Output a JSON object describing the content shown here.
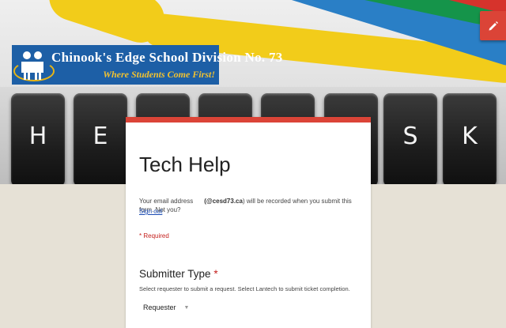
{
  "banner": {
    "keys": [
      "H",
      "E",
      "",
      "",
      "",
      "",
      "S",
      "K"
    ],
    "logo": {
      "name": "Chinook's Edge School Division No. 73",
      "tagline": "Where Students Come First!"
    }
  },
  "edit_button": {
    "icon": "pencil-icon"
  },
  "form": {
    "accent_color": "#db4437",
    "title": "Tech Help",
    "email_label": "Your email address",
    "email_domain": "(@cesd73.ca",
    "email_notice": ") will be recorded when you submit this form. Not you?",
    "sign_out": "Sign out",
    "required_note": "* Required",
    "question": {
      "title": "Submitter Type",
      "required_mark": "*",
      "description": "Select requester to submit a request. Select Lantech to submit ticket completion.",
      "selected_value": "Requester",
      "arrow_icon": "dropdown-arrow-icon"
    }
  }
}
